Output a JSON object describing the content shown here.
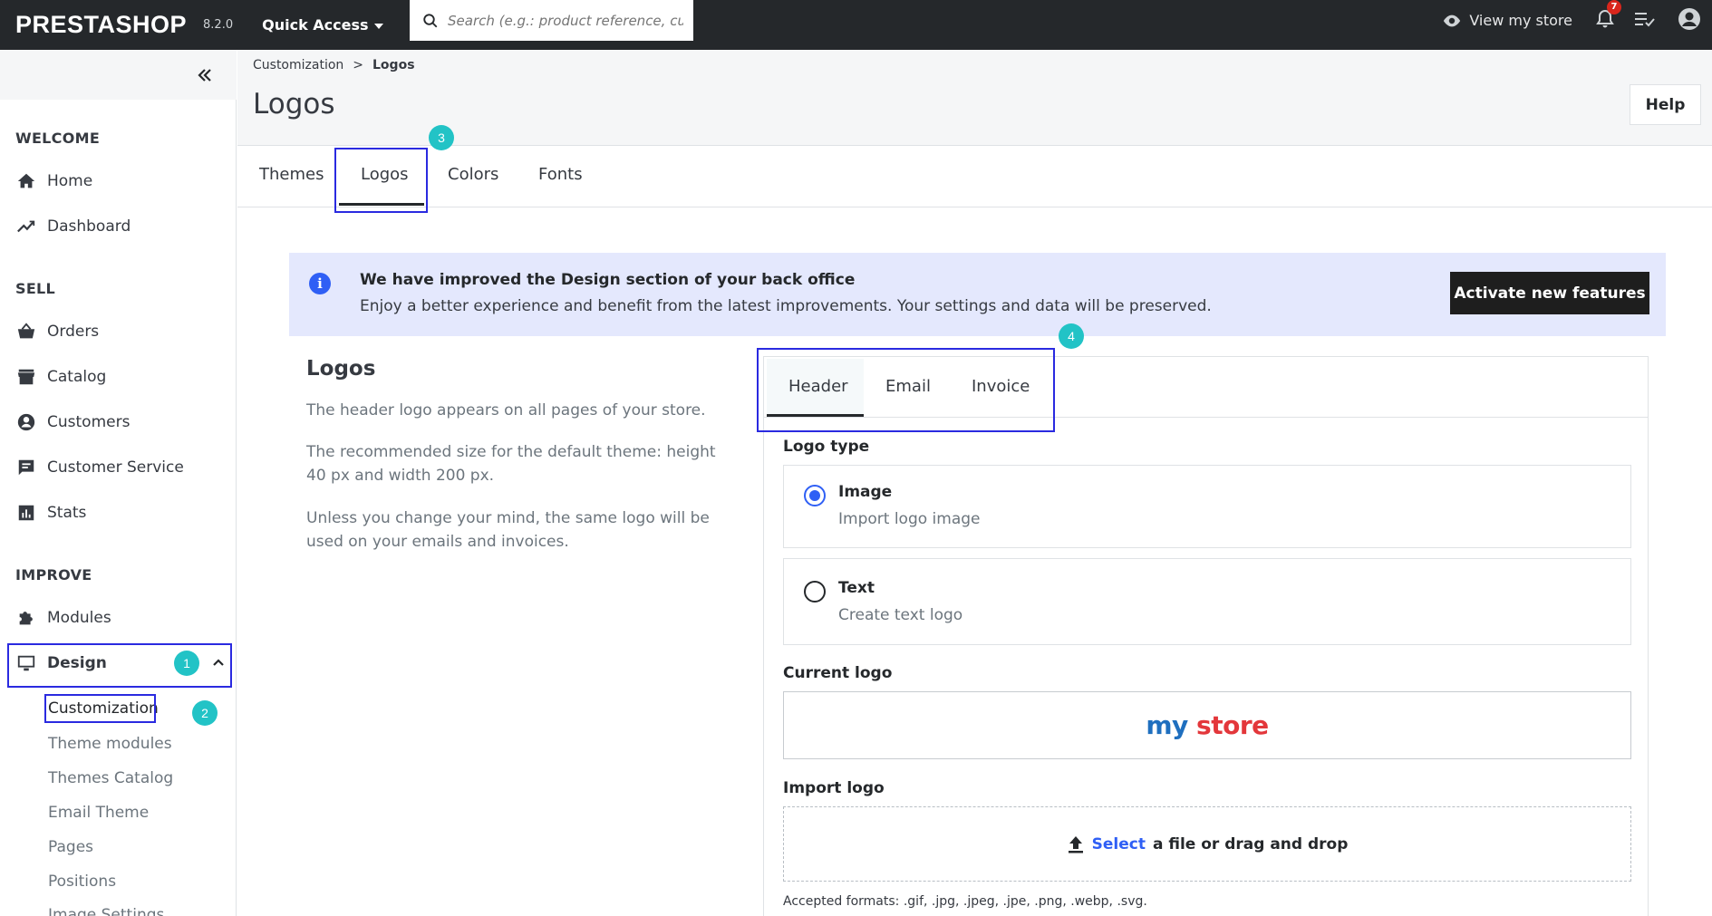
{
  "topbar": {
    "brand": "PRESTASHOP",
    "version": "8.2.0",
    "quick_access": "Quick Access",
    "search_placeholder": "Search (e.g.: product reference, custon",
    "view_store": "View my store",
    "notifications_count": "7"
  },
  "sidebar": {
    "sections": {
      "welcome": "WELCOME",
      "sell": "SELL",
      "improve": "IMPROVE"
    },
    "items": {
      "home": "Home",
      "dashboard": "Dashboard",
      "orders": "Orders",
      "catalog": "Catalog",
      "customers": "Customers",
      "customer_service": "Customer Service",
      "stats": "Stats",
      "modules": "Modules",
      "design": "Design"
    },
    "design_sub": {
      "customization": "Customization",
      "theme_modules": "Theme modules",
      "themes_catalog": "Themes Catalog",
      "email_theme": "Email Theme",
      "pages": "Pages",
      "positions": "Positions",
      "image_settings": "Image Settings"
    }
  },
  "annotations": {
    "n1": "1",
    "n2": "2",
    "n3": "3",
    "n4": "4"
  },
  "header": {
    "breadcrumb_parent": "Customization",
    "breadcrumb_sep": ">",
    "breadcrumb_current": "Logos",
    "title": "Logos",
    "help": "Help"
  },
  "tabs": {
    "themes": "Themes",
    "logos": "Logos",
    "colors": "Colors",
    "fonts": "Fonts"
  },
  "alert": {
    "title": "We have improved the Design section of your back office",
    "text": "Enjoy a better experience and benefit from the latest improvements. Your settings and data will be preserved.",
    "button": "Activate new features"
  },
  "description": {
    "title": "Logos",
    "p1": "The header logo appears on all pages of your store.",
    "p2": "The recommended size for the default theme: height 40 px and width 200 px.",
    "p3": "Unless you change your mind, the same logo will be used on your emails and invoices."
  },
  "card": {
    "tabs": {
      "header": "Header",
      "email": "Email",
      "invoice": "Invoice"
    },
    "logo_type_label": "Logo type",
    "image_option": {
      "title": "Image",
      "sub": "Import logo image"
    },
    "text_option": {
      "title": "Text",
      "sub": "Create text logo"
    },
    "current_logo_label": "Current logo",
    "logo_my": "my",
    "logo_store": "store",
    "import_label": "Import logo",
    "drop_select": "Select",
    "drop_rest": "a file or drag and drop",
    "formats": "Accepted formats: .gif, .jpg, .jpeg, .jpe, .png, .webp, .svg."
  }
}
